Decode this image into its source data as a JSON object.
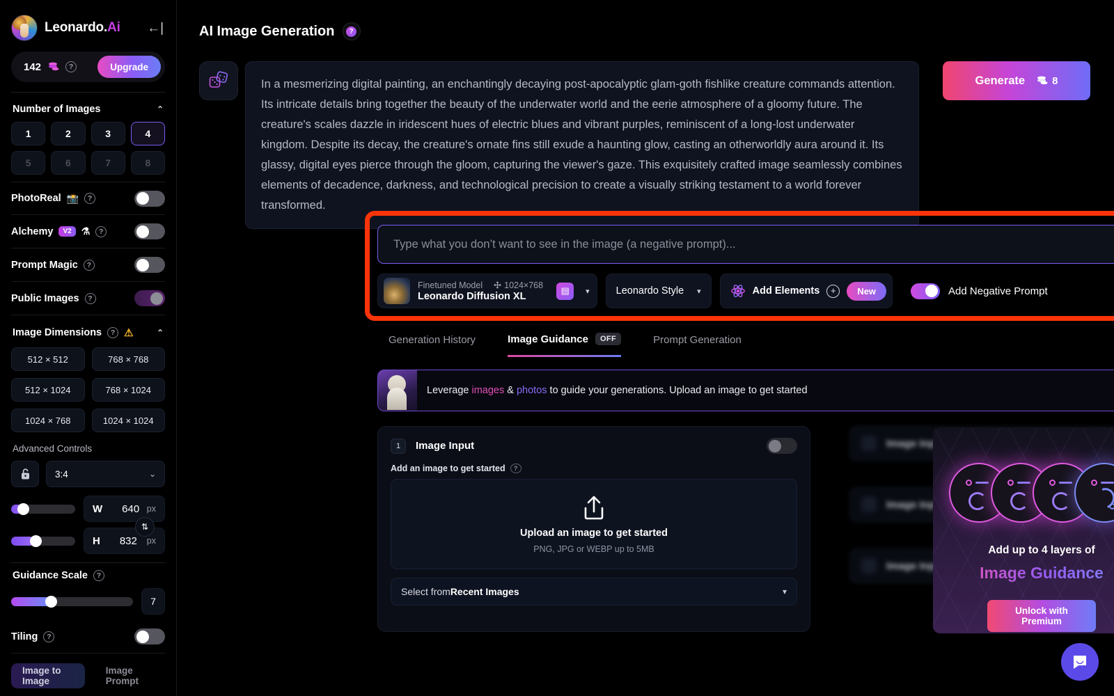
{
  "sidebar": {
    "brand": {
      "name": "Leonardo.",
      "accent": "Ai",
      "collapse_icon": "←|"
    },
    "credits": {
      "amount": "142",
      "coin_icon": "coins-icon",
      "help_icon": "?",
      "upgrade_label": "Upgrade"
    },
    "number_of_images": {
      "title": "Number of Images",
      "chevron": "⌃",
      "options": [
        "1",
        "2",
        "3",
        "4",
        "5",
        "6",
        "7",
        "8"
      ],
      "selected": "4",
      "disabled": [
        "5",
        "6",
        "7",
        "8"
      ]
    },
    "toggles": [
      {
        "label": "PhotoReal",
        "emoji": "📸",
        "help": "?",
        "state": "off"
      },
      {
        "label": "Alchemy",
        "badge": "V2",
        "emoji": "⚗",
        "help": "?",
        "state": "off"
      },
      {
        "label": "Prompt Magic",
        "help": "?",
        "state": "off"
      },
      {
        "label": "Public Images",
        "help": "?",
        "state": "on"
      }
    ],
    "image_dimensions": {
      "title": "Image Dimensions",
      "help": "?",
      "warning_icon": "⚠",
      "chevron": "⌃",
      "presets": [
        "512 × 512",
        "768 × 768",
        "512 × 1024",
        "768 × 1024",
        "1024 × 768",
        "1024 × 1024"
      ]
    },
    "advanced_controls": {
      "label": "Advanced Controls",
      "lock_icon": "🔓",
      "aspect_ratio": "3:4",
      "aspect_chevron": "⌄",
      "width": {
        "label": "W",
        "value": "640",
        "unit": "px"
      },
      "height": {
        "label": "H",
        "value": "832",
        "unit": "px"
      },
      "swap_icon": "⇅"
    },
    "guidance_scale": {
      "title": "Guidance Scale",
      "help": "?",
      "value": "7"
    },
    "tiling": {
      "label": "Tiling",
      "help": "?",
      "state": "off"
    },
    "bottom_tabs": [
      {
        "label": "Image to Image",
        "selected": true
      },
      {
        "label": "Image Prompt",
        "selected": false
      }
    ]
  },
  "header": {
    "title": "AI Image Generation",
    "help_icon": "?"
  },
  "prompt": {
    "dice_icon": "dice-icon",
    "text": "In a mesmerizing digital painting, an enchantingly decaying post-apocalyptic glam-goth fishlike creature commands attention. Its intricate details bring together the beauty of the underwater world and the eerie atmosphere of a gloomy future. The creature's scales dazzle in iridescent hues of electric blues and vibrant purples, reminiscent of a long-lost underwater kingdom. Despite its decay, the creature's ornate fins still exude a haunting glow, casting an otherworldly aura around it. Its glassy, digital eyes pierce through the gloom, capturing the viewer's gaze. This exquisitely crafted image seamlessly combines elements of decadence, darkness, and technological precision to create a visually striking testament to a world forever transformed."
  },
  "generate": {
    "label": "Generate",
    "cost": "8",
    "coin_icon": "coins-icon"
  },
  "negative_prompt": {
    "placeholder": "Type what you don’t want to see in the image (a negative prompt)..."
  },
  "controls": {
    "model": {
      "kind_label": "Finetuned Model",
      "dims": "1024×768",
      "dims_icon": "move-icon",
      "name": "Leonardo Diffusion XL",
      "edit_icon": "note-icon",
      "chevron": "▾"
    },
    "style": {
      "label": "Leonardo Style",
      "chevron": "▾"
    },
    "elements": {
      "label": "Add Elements",
      "plus": "+",
      "badge": "New",
      "atom_icon": "atom-icon"
    },
    "negative_toggle": {
      "label": "Add Negative Prompt",
      "state": "on"
    }
  },
  "tabs": [
    {
      "label": "Generation History",
      "active": false
    },
    {
      "label": "Image Guidance",
      "active": true,
      "badge": "OFF"
    },
    {
      "label": "Prompt Generation",
      "active": false
    }
  ],
  "banner": {
    "lead": "Leverage ",
    "hl1": "images",
    "amp": " & ",
    "hl2": "photos",
    "rest": " to guide your generations. Upload an image to get started"
  },
  "image_input_card": {
    "step": "1",
    "title": "Image Input",
    "toggle_state": "off",
    "sub_label": "Add an image to get started",
    "sub_help": "?",
    "upload_icon": "upload-icon",
    "dropzone_title": "Upload an image to get started",
    "dropzone_sub": "PNG, JPG or WEBP up to 5MB",
    "recent_lead": "Select from ",
    "recent_bold": "Recent Images",
    "recent_chevron": "▾"
  },
  "blurred_rows": [
    {
      "step": "2",
      "title": "Image Input"
    },
    {
      "step": "3",
      "title": "Image Input"
    },
    {
      "step": "4",
      "title": "Image Input"
    }
  ],
  "promo": {
    "line1": "Add up to 4 layers of",
    "line2": "Image Guidance",
    "button": "Unlock with Premium"
  },
  "intercom": {
    "icon": "chat-bubble-icon"
  },
  "colors": {
    "accent_pink": "#e84bc2",
    "accent_purple": "#8b5cf6",
    "accent_blue": "#6b7df6",
    "highlight_red": "#fa3409",
    "warning_yellow": "#f0b429"
  }
}
